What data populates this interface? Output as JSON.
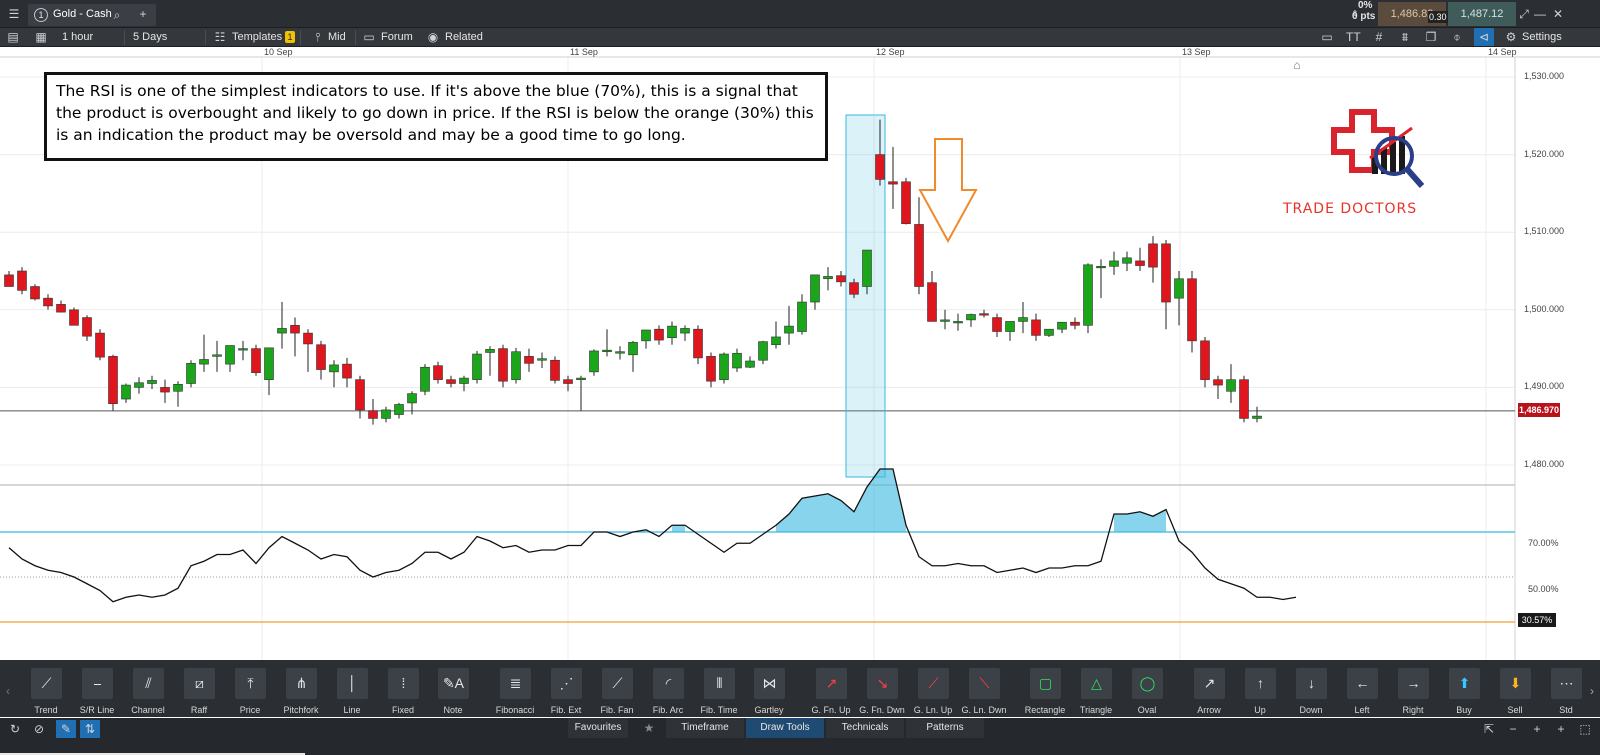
{
  "header": {
    "tab_number": "1",
    "instrument": "Gold - Cash",
    "change_pct": "0%",
    "change_pts": "0 pts",
    "sell_price": "1,486.82",
    "spread": "0.30",
    "buy_price": "1,487.12"
  },
  "toolbar": {
    "timeframe": "1 hour",
    "range": "5 Days",
    "templates": "Templates",
    "templates_badge": "1",
    "price_type": "Mid",
    "forum": "Forum",
    "related": "Related",
    "settings": "Settings"
  },
  "chart": {
    "date_labels": [
      "10 Sep",
      "11 Sep",
      "12 Sep",
      "13 Sep",
      "14 Sep"
    ],
    "price_ticks": [
      "1,530.000",
      "1,520.000",
      "1,510.000",
      "1,500.000",
      "1,490.000",
      "1,480.000"
    ],
    "current_price": "1,486.970",
    "rsi_ticks": [
      "70.00%",
      "50.00%"
    ],
    "rsi_current": "30.57%",
    "annotation": "The RSI is one of the simplest indicators to use. If it's above the blue (70%), this is a signal that the product is overbought and likely to go down in price. If the RSI is below the orange (30%) this is an indication the product may be oversold and may be a good time to go long.",
    "logo_text": "TRADE DOCTORS",
    "colors": {
      "up": "#1aa51a",
      "down": "#e0161f",
      "overbought": "#39b8e0",
      "oversold": "#f0a030",
      "arrow": "#f08a2a"
    }
  },
  "chart_data": {
    "type": "candlestick",
    "candles": [
      [
        1504.5,
        1505.0,
        1503.0,
        1503.0
      ],
      [
        1505.0,
        1505.5,
        1502.5,
        1502.0
      ],
      [
        1503.0,
        1503.3,
        1501.4,
        1501.2
      ],
      [
        1501.5,
        1502.0,
        1500.5,
        1500.0
      ],
      [
        1500.7,
        1501.2,
        1499.7,
        1499.7
      ],
      [
        1500.0,
        1500.3,
        1498.0,
        1499.0
      ],
      [
        1499.0,
        1499.3,
        1496.6,
        1496.0
      ],
      [
        1497.0,
        1497.5,
        1493.9,
        1493.5
      ],
      [
        1494.0,
        1494.2,
        1487.9,
        1487.0
      ],
      [
        1488.5,
        1490.5,
        1490.3,
        1488.0
      ],
      [
        1490.0,
        1491.3,
        1490.6,
        1489.2
      ],
      [
        1490.5,
        1491.5,
        1490.9,
        1489.8
      ],
      [
        1490.0,
        1491.0,
        1489.4,
        1488.0
      ],
      [
        1489.5,
        1490.8,
        1490.4,
        1487.5
      ],
      [
        1490.5,
        1493.5,
        1493.1,
        1490.0
      ],
      [
        1493.0,
        1496.8,
        1493.6,
        1492.0
      ],
      [
        1494.0,
        1496.0,
        1494.2,
        1492.0
      ],
      [
        1493.0,
        1495.4,
        1495.4,
        1492.0
      ],
      [
        1495.0,
        1496.0,
        1495.0,
        1493.5
      ],
      [
        1495.0,
        1495.5,
        1491.9,
        1491.5
      ],
      [
        1491.0,
        1495.0,
        1495.1,
        1489.0
      ],
      [
        1497.0,
        1501.0,
        1497.6,
        1495.0
      ],
      [
        1498.0,
        1499.0,
        1497.0,
        1494.0
      ],
      [
        1497.0,
        1497.5,
        1495.6,
        1492.0
      ],
      [
        1495.5,
        1496.0,
        1492.3,
        1491.0
      ],
      [
        1492.0,
        1493.5,
        1492.9,
        1490.0
      ],
      [
        1493.0,
        1493.8,
        1491.2,
        1490.0
      ],
      [
        1491.0,
        1491.5,
        1487.1,
        1486.0
      ],
      [
        1487.0,
        1488.5,
        1486.0,
        1485.2
      ],
      [
        1486.0,
        1487.5,
        1487.1,
        1485.5
      ],
      [
        1486.5,
        1488.0,
        1487.8,
        1486.0
      ],
      [
        1488.0,
        1489.5,
        1489.2,
        1486.5
      ],
      [
        1489.5,
        1493.0,
        1492.6,
        1489.0
      ],
      [
        1492.8,
        1493.3,
        1491.0,
        1490.5
      ],
      [
        1491.0,
        1491.5,
        1490.5,
        1490.0
      ],
      [
        1490.5,
        1491.5,
        1491.2,
        1489.5
      ],
      [
        1491.0,
        1494.7,
        1494.3,
        1490.5
      ],
      [
        1494.5,
        1495.3,
        1494.9,
        1491.5
      ],
      [
        1495.0,
        1495.5,
        1490.8,
        1490.0
      ],
      [
        1491.0,
        1495.1,
        1494.6,
        1490.5
      ],
      [
        1494.0,
        1495.0,
        1493.1,
        1492.0
      ],
      [
        1493.5,
        1494.5,
        1493.7,
        1492.5
      ],
      [
        1493.5,
        1494.0,
        1490.9,
        1490.5
      ],
      [
        1491.0,
        1491.5,
        1490.5,
        1489.5
      ],
      [
        1491.0,
        1491.5,
        1491.2,
        1487.0
      ],
      [
        1492.0,
        1494.9,
        1494.7,
        1491.5
      ],
      [
        1494.7,
        1497.5,
        1494.8,
        1494.0
      ],
      [
        1494.5,
        1495.3,
        1494.6,
        1493.6
      ],
      [
        1494.2,
        1496.0,
        1495.8,
        1492.0
      ],
      [
        1496.0,
        1497.0,
        1497.4,
        1495.0
      ],
      [
        1497.5,
        1498.0,
        1496.1,
        1495.5
      ],
      [
        1496.4,
        1498.5,
        1497.9,
        1495.5
      ],
      [
        1497.0,
        1498.0,
        1497.6,
        1496.0
      ],
      [
        1497.5,
        1498.0,
        1493.8,
        1493.0
      ],
      [
        1494.0,
        1494.5,
        1490.8,
        1490.0
      ],
      [
        1491.0,
        1494.5,
        1494.3,
        1490.5
      ],
      [
        1492.5,
        1495.0,
        1494.4,
        1492.0
      ],
      [
        1492.6,
        1494.0,
        1493.4,
        1492.5
      ],
      [
        1493.5,
        1496.0,
        1495.9,
        1493.0
      ],
      [
        1495.5,
        1498.5,
        1496.5,
        1495.0
      ],
      [
        1497.0,
        1500.5,
        1497.9,
        1495.5
      ],
      [
        1497.2,
        1502.0,
        1501.0,
        1496.8
      ],
      [
        1501.0,
        1504.0,
        1504.5,
        1500.0
      ],
      [
        1504.0,
        1505.5,
        1504.3,
        1502.5
      ],
      [
        1504.4,
        1505.0,
        1503.6,
        1503.0
      ],
      [
        1503.5,
        1504.0,
        1502.0,
        1501.5
      ],
      [
        1503.0,
        1507.5,
        1507.7,
        1502.0
      ],
      [
        1520.0,
        1524.5,
        1516.8,
        1516.0
      ],
      [
        1516.5,
        1521.0,
        1516.2,
        1513.0
      ],
      [
        1516.5,
        1517.0,
        1511.1,
        1511.0
      ],
      [
        1511.0,
        1514.5,
        1503.0,
        1502.0
      ],
      [
        1503.5,
        1505.0,
        1498.5,
        1498.5
      ],
      [
        1498.5,
        1500.0,
        1498.7,
        1497.5
      ],
      [
        1498.5,
        1499.5,
        1498.5,
        1497.3
      ],
      [
        1498.7,
        1499.5,
        1499.4,
        1497.8
      ],
      [
        1499.5,
        1500.0,
        1499.4,
        1499.0
      ],
      [
        1499.0,
        1499.5,
        1497.2,
        1496.5
      ],
      [
        1497.2,
        1498.5,
        1498.5,
        1496.0
      ],
      [
        1498.5,
        1501.0,
        1499.0,
        1497.0
      ],
      [
        1498.7,
        1499.5,
        1496.7,
        1496.0
      ],
      [
        1496.7,
        1497.5,
        1497.5,
        1496.5
      ],
      [
        1497.5,
        1498.2,
        1498.4,
        1497.0
      ],
      [
        1498.4,
        1499.0,
        1498.0,
        1497.5
      ],
      [
        1498.0,
        1506.0,
        1505.8,
        1497.0
      ],
      [
        1505.5,
        1506.5,
        1505.6,
        1501.5
      ],
      [
        1505.6,
        1507.5,
        1506.3,
        1504.5
      ],
      [
        1506.0,
        1507.5,
        1506.7,
        1505.0
      ],
      [
        1506.3,
        1508.0,
        1505.7,
        1505.0
      ],
      [
        1508.5,
        1509.5,
        1505.5,
        1503.5
      ],
      [
        1508.5,
        1509.0,
        1501.0,
        1497.5
      ],
      [
        1501.5,
        1505.0,
        1504.0,
        1498.0
      ],
      [
        1504.0,
        1505.0,
        1496.0,
        1494.5
      ],
      [
        1496.0,
        1496.5,
        1491.0,
        1490.0
      ],
      [
        1491.0,
        1491.5,
        1490.3,
        1488.5
      ],
      [
        1489.5,
        1493.0,
        1491.0,
        1488.0
      ],
      [
        1491.0,
        1491.5,
        1486.0,
        1485.5
      ],
      [
        1486.0,
        1487.5,
        1486.3,
        1485.5
      ]
    ],
    "rsi": [
      63,
      58,
      55,
      53,
      52,
      50,
      47,
      44,
      39,
      41,
      42,
      41,
      42,
      45,
      55,
      57,
      60,
      60,
      62,
      56,
      63,
      68,
      65,
      62,
      58,
      60,
      59,
      53,
      50,
      52,
      53,
      56,
      61,
      61,
      58,
      61,
      68,
      66,
      63,
      64,
      61,
      62,
      62,
      64,
      64,
      70,
      70,
      68,
      70,
      71,
      68,
      73,
      73,
      69,
      65,
      61,
      65,
      65,
      69,
      73,
      78,
      85,
      86,
      87,
      84,
      79,
      90,
      98,
      98,
      73,
      59,
      55,
      55,
      56,
      55,
      55,
      52,
      53,
      54,
      52,
      54,
      54,
      55,
      55,
      57,
      78,
      78,
      79,
      77,
      80,
      66,
      61,
      54,
      49,
      47,
      45,
      41,
      41,
      40,
      41
    ],
    "ylim": [
      1477.0,
      1531.0
    ],
    "rsi_levels": [
      70,
      50,
      30
    ]
  },
  "drawtools": [
    {
      "label": "Trend",
      "icon": "trend-icon",
      "glyph": "⟋"
    },
    {
      "label": "S/R Line",
      "icon": "sr-line-icon",
      "glyph": "⎯"
    },
    {
      "label": "Channel",
      "icon": "channel-icon",
      "glyph": "⫽"
    },
    {
      "label": "Raff",
      "icon": "raff-icon",
      "glyph": "⧄"
    },
    {
      "label": "Price",
      "icon": "price-icon",
      "glyph": "⤒"
    },
    {
      "label": "Pitchfork",
      "icon": "pitchfork-icon",
      "glyph": "⋔"
    },
    {
      "label": "Line",
      "icon": "line-icon",
      "glyph": "│"
    },
    {
      "label": "Fixed",
      "icon": "fixed-icon",
      "glyph": "⁞"
    },
    {
      "label": "Note",
      "icon": "note-icon",
      "glyph": "✎A"
    },
    {
      "label": "Fibonacci",
      "icon": "fibonacci-icon",
      "glyph": "≣"
    },
    {
      "label": "Fib. Ext",
      "icon": "fib-ext-icon",
      "glyph": "⋰"
    },
    {
      "label": "Fib. Fan",
      "icon": "fib-fan-icon",
      "glyph": "⟋"
    },
    {
      "label": "Fib. Arc",
      "icon": "fib-arc-icon",
      "glyph": "◜"
    },
    {
      "label": "Fib. Time",
      "icon": "fib-time-icon",
      "glyph": "⦀"
    },
    {
      "label": "Gartley",
      "icon": "gartley-icon",
      "glyph": "⋈"
    },
    {
      "label": "G. Fn. Up",
      "icon": "gann-fan-up-icon",
      "glyph": "↗"
    },
    {
      "label": "G. Fn. Dwn",
      "icon": "gann-fan-down-icon",
      "glyph": "↘"
    },
    {
      "label": "G. Ln. Up",
      "icon": "gann-line-up-icon",
      "glyph": "⟋"
    },
    {
      "label": "G. Ln. Dwn",
      "icon": "gann-line-down-icon",
      "glyph": "⟍"
    },
    {
      "label": "Rectangle",
      "icon": "rectangle-icon",
      "glyph": "▢"
    },
    {
      "label": "Triangle",
      "icon": "triangle-icon",
      "glyph": "△"
    },
    {
      "label": "Oval",
      "icon": "oval-icon",
      "glyph": "◯"
    },
    {
      "label": "Arrow",
      "icon": "arrow-icon",
      "glyph": "↗"
    },
    {
      "label": "Up",
      "icon": "up-arrow-icon",
      "glyph": "↑"
    },
    {
      "label": "Down",
      "icon": "down-arrow-icon",
      "glyph": "↓"
    },
    {
      "label": "Left",
      "icon": "left-arrow-icon",
      "glyph": "←"
    },
    {
      "label": "Right",
      "icon": "right-arrow-icon",
      "glyph": "→"
    },
    {
      "label": "Buy",
      "icon": "buy-icon",
      "glyph": "⬆"
    },
    {
      "label": "Sell",
      "icon": "sell-icon",
      "glyph": "⬇"
    },
    {
      "label": "Std",
      "icon": "std-icon",
      "glyph": "⋯"
    }
  ],
  "bottom_tabs": [
    "Favourites",
    "Timeframe",
    "Draw Tools",
    "Technicals",
    "Patterns"
  ],
  "bottom_active": "Draw Tools"
}
